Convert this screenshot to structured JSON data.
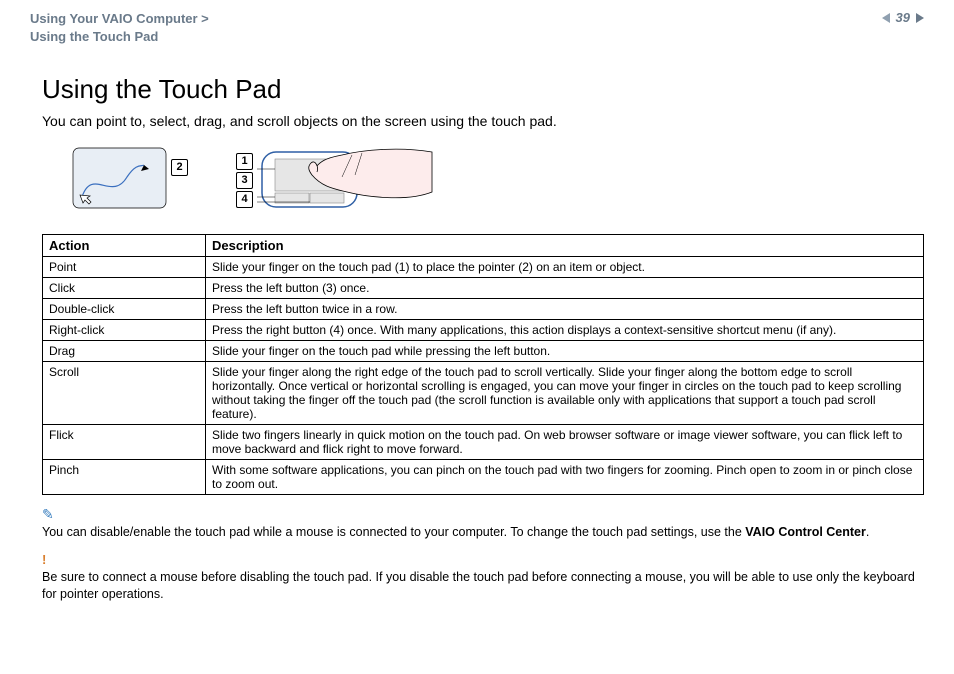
{
  "header": {
    "breadcrumb_line1": "Using Your VAIO Computer >",
    "breadcrumb_line2": "Using the Touch Pad",
    "page_number": "39"
  },
  "title": "Using the Touch Pad",
  "intro": "You can point to, select, drag, and scroll objects on the screen using the touch pad.",
  "diagram": {
    "callouts": [
      "1",
      "2",
      "3",
      "4"
    ]
  },
  "table": {
    "header_action": "Action",
    "header_description": "Description",
    "rows": [
      {
        "action": "Point",
        "description": "Slide your finger on the touch pad (1) to place the pointer (2) on an item or object."
      },
      {
        "action": "Click",
        "description": "Press the left button (3) once."
      },
      {
        "action": "Double-click",
        "description": "Press the left button twice in a row."
      },
      {
        "action": "Right-click",
        "description": "Press the right button (4) once. With many applications, this action displays a context-sensitive shortcut menu (if any)."
      },
      {
        "action": "Drag",
        "description": "Slide your finger on the touch pad while pressing the left button."
      },
      {
        "action": "Scroll",
        "description": "Slide your finger along the right edge of the touch pad to scroll vertically. Slide your finger along the bottom edge to scroll horizontally. Once vertical or horizontal scrolling is engaged, you can move your finger in circles on the touch pad to keep scrolling without taking the finger off the touch pad (the scroll function is available only with applications that support a touch pad scroll feature)."
      },
      {
        "action": "Flick",
        "description": "Slide two fingers linearly in quick motion on the touch pad. On web browser software or image viewer software, you can flick left to move backward and flick right to move forward."
      },
      {
        "action": "Pinch",
        "description": "With some software applications, you can pinch on the touch pad with two fingers for zooming. Pinch open to zoom in or pinch close to zoom out."
      }
    ]
  },
  "notes": {
    "tip_pre": "You can disable/enable the touch pad while a mouse is connected to your computer. To change the touch pad settings, use the ",
    "tip_bold": "VAIO Control Center",
    "tip_post": ".",
    "warning": "Be sure to connect a mouse before disabling the touch pad. If you disable the touch pad before connecting a mouse, you will be able to use only the keyboard for pointer operations."
  }
}
